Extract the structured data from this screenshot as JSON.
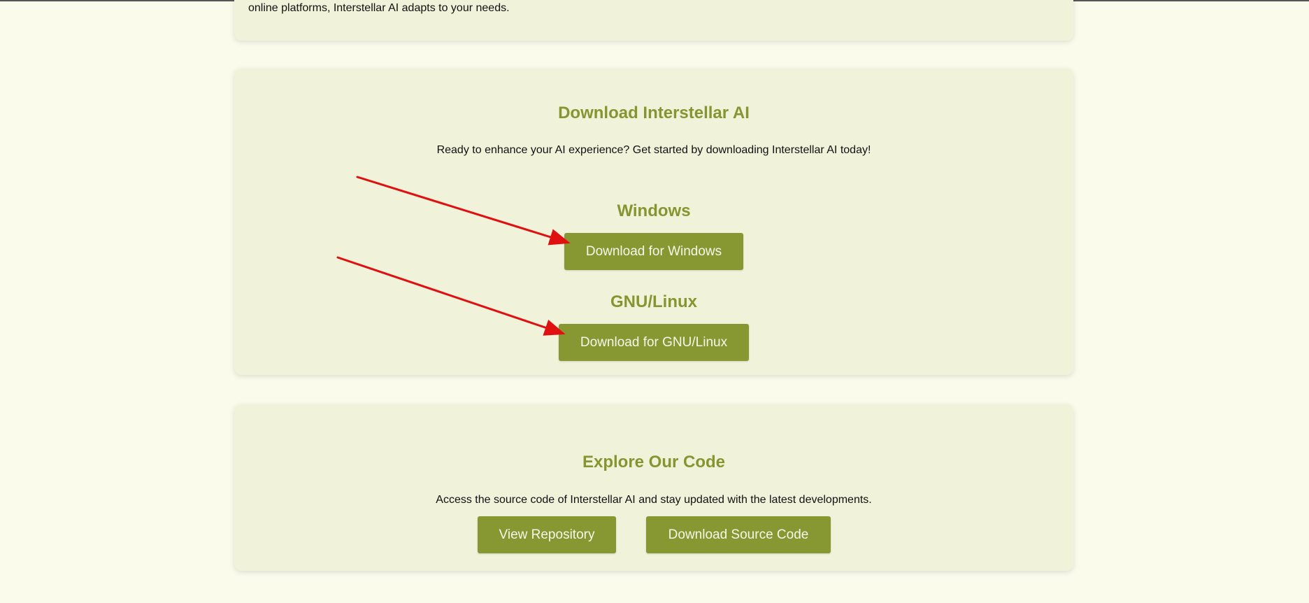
{
  "intro": {
    "tail_text": "online platforms, Interstellar AI adapts to your needs."
  },
  "download": {
    "title": "Download Interstellar AI",
    "text": "Ready to enhance your AI experience? Get started by downloading Interstellar AI today!",
    "windows": {
      "title": "Windows",
      "button_label": "Download for Windows"
    },
    "linux": {
      "title": "GNU/Linux",
      "button_label": "Download for GNU/Linux"
    }
  },
  "code": {
    "title": "Explore Our Code",
    "text": "Access the source code of Interstellar AI and stay updated with the latest developments.",
    "view_repo_label": "View Repository",
    "download_source_label": "Download Source Code"
  },
  "colors": {
    "page_background": "#fbfbec",
    "card_background": "#f0f2da",
    "accent": "#869530",
    "button_background": "#879833",
    "button_text": "#f6f7e8",
    "annotation_arrow": "#e01010"
  },
  "icons": {
    "annotation_arrows": "red-arrow-icon"
  }
}
